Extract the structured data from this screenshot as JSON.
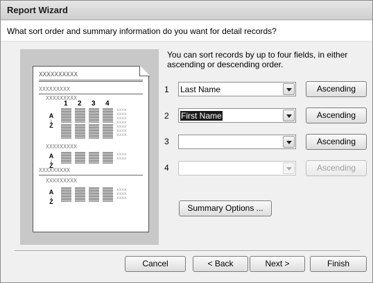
{
  "window": {
    "title": "Report Wizard"
  },
  "header": {
    "question": "What sort order and summary information do you want for detail records?"
  },
  "intro_text": "You can sort records by up to four fields, in either ascending or descending order.",
  "preview": {
    "title_placeholder": "XXXXXXXXXX",
    "group_placeholder": "XXXXXXXXX",
    "field_numbers": [
      "1",
      "2",
      "3",
      "4"
    ],
    "sort_glyph_top": "A",
    "sort_glyph_bottom": "Z"
  },
  "sort_rows": [
    {
      "number": "1",
      "field": "Last Name",
      "order": "Ascending",
      "enabled": true
    },
    {
      "number": "2",
      "field": "First Name",
      "order": "Ascending",
      "enabled": true
    },
    {
      "number": "3",
      "field": "",
      "order": "Ascending",
      "enabled": true
    },
    {
      "number": "4",
      "field": "",
      "order": "Ascending",
      "enabled": false
    }
  ],
  "buttons": {
    "summary_options": "Summary Options ...",
    "cancel": "Cancel",
    "back": "< Back",
    "next": "Next >",
    "finish": "Finish"
  }
}
